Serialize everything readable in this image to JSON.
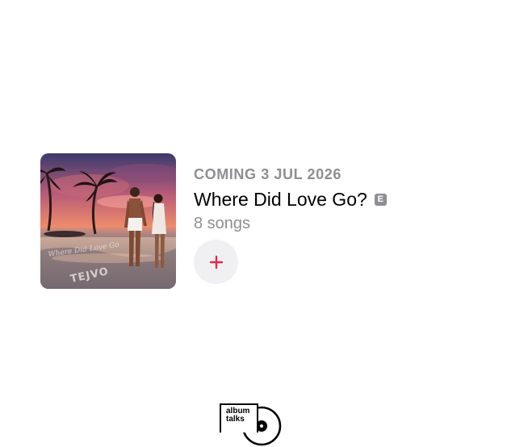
{
  "album": {
    "release_date": "COMING 3 JUL 2026",
    "title": "Where Did Love Go?",
    "explicit_badge": "E",
    "song_count": "8 songs",
    "artwork_text": {
      "script_line": "Where Did Love Go",
      "artist_mark": "TEJVO"
    }
  },
  "add_button": {
    "icon": "plus-icon",
    "color": "#e0294a"
  },
  "watermark": {
    "line1": "album",
    "line2": "talks"
  },
  "colors": {
    "secondary_text": "#8e8e93",
    "accent": "#e0294a",
    "button_bg": "#f0f0f2"
  }
}
